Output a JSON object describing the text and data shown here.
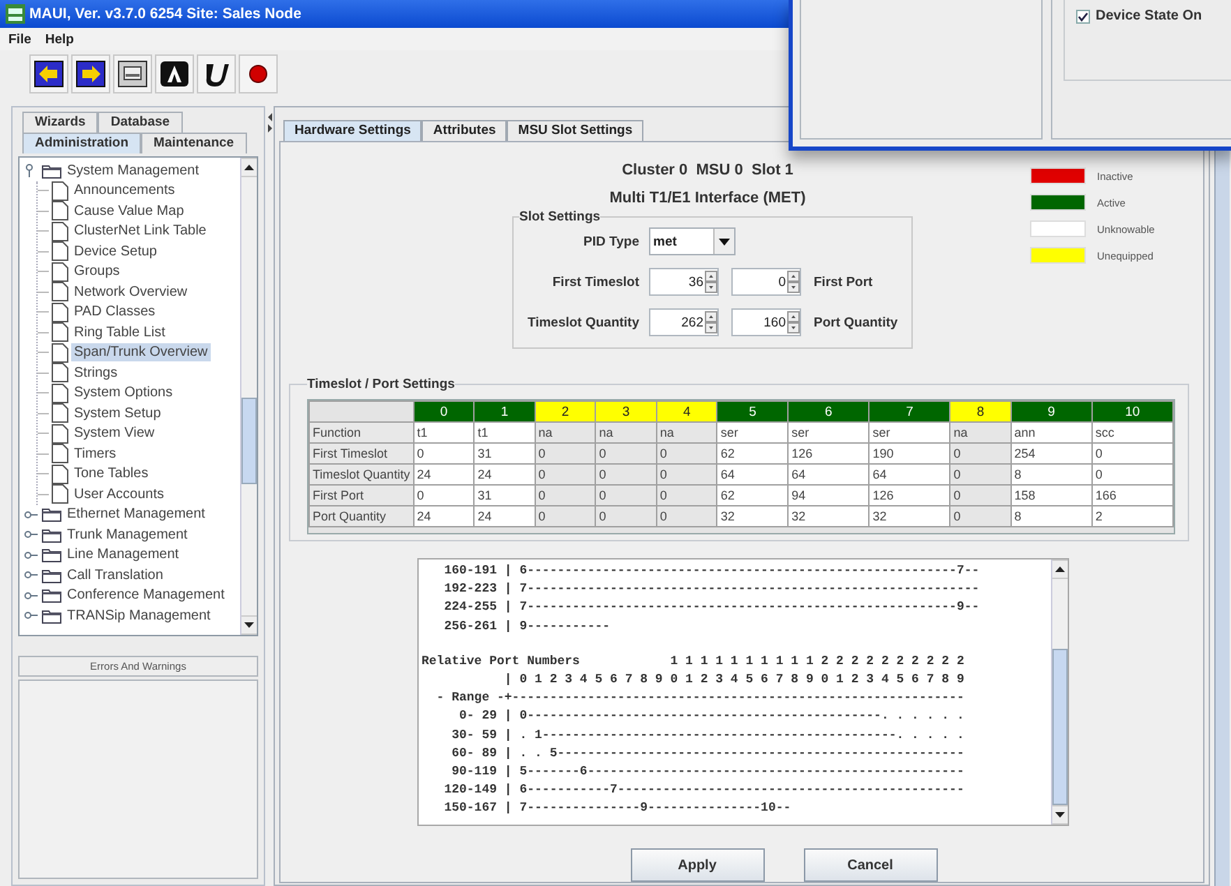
{
  "window": {
    "title": "MAUI, Ver. v3.7.0 6254 Site: Sales Node"
  },
  "menu": [
    "File",
    "Help"
  ],
  "toolbar": [
    {
      "kind": "back"
    },
    {
      "kind": "forward"
    },
    {
      "kind": "print"
    },
    {
      "kind": "letter-a"
    },
    {
      "kind": "letter-u"
    },
    {
      "kind": "record"
    }
  ],
  "left_panel": {
    "tab_rows": [
      [
        {
          "label": "Wizards",
          "selected": false
        },
        {
          "label": "Database",
          "selected": false
        }
      ],
      [
        {
          "label": "Administration",
          "selected": true
        },
        {
          "label": "Maintenance",
          "selected": false
        }
      ]
    ],
    "tree": [
      {
        "label": "System Management",
        "expanded": true,
        "selected": false,
        "children": [
          {
            "label": "Announcements",
            "selected": false
          },
          {
            "label": "Cause Value Map",
            "selected": false
          },
          {
            "label": "ClusterNet Link Table",
            "selected": false
          },
          {
            "label": "Device Setup",
            "selected": false
          },
          {
            "label": "Groups",
            "selected": false
          },
          {
            "label": "Network Overview",
            "selected": false
          },
          {
            "label": "PAD Classes",
            "selected": false
          },
          {
            "label": "Ring Table List",
            "selected": false
          },
          {
            "label": "Span/Trunk Overview",
            "selected": true
          },
          {
            "label": "Strings",
            "selected": false
          },
          {
            "label": "System Options",
            "selected": false
          },
          {
            "label": "System Setup",
            "selected": false
          },
          {
            "label": "System View",
            "selected": false
          },
          {
            "label": "Timers",
            "selected": false
          },
          {
            "label": "Tone Tables",
            "selected": false
          },
          {
            "label": "User Accounts",
            "selected": false
          }
        ]
      },
      {
        "label": "Ethernet Management",
        "expanded": false,
        "selected": false
      },
      {
        "label": "Trunk Management",
        "expanded": false,
        "selected": false
      },
      {
        "label": "Line Management",
        "expanded": false,
        "selected": false
      },
      {
        "label": "Call Translation",
        "expanded": false,
        "selected": false
      },
      {
        "label": "Conference Management",
        "expanded": false,
        "selected": false
      },
      {
        "label": "TRANSip Management",
        "expanded": false,
        "selected": false
      }
    ],
    "errors_panel": {
      "title": "Errors And Warnings"
    }
  },
  "main_panel": {
    "tabs": [
      {
        "label": "Hardware Settings",
        "selected": true
      },
      {
        "label": "Attributes",
        "selected": false
      },
      {
        "label": "MSU Slot Settings",
        "selected": false
      }
    ],
    "heading": "Cluster 0  MSU 0  Slot 1",
    "subheading": "Multi T1/E1 Interface (MET)",
    "slot_settings": {
      "title": "Slot Settings",
      "pid_type": {
        "label": "PID Type",
        "value": "met"
      },
      "first_timeslot": {
        "label": "First Timeslot",
        "value": "36"
      },
      "first_port": {
        "label": "First Port",
        "value": "0"
      },
      "timeslot_quantity": {
        "label": "Timeslot Quantity",
        "value": "262"
      },
      "port_quantity": {
        "label": "Port Quantity",
        "value": "160"
      }
    },
    "legend": [
      {
        "label": "Inactive",
        "color": "#e00000"
      },
      {
        "label": "Active",
        "color": "#006600"
      },
      {
        "label": "Unknowable",
        "color": "#ffffff"
      },
      {
        "label": "Unequipped",
        "color": "#ffff00"
      }
    ],
    "port_settings": {
      "title": "Timeslot / Port Settings",
      "columns": [
        {
          "label": "0",
          "color": "#006600",
          "equipped": true
        },
        {
          "label": "1",
          "color": "#006600",
          "equipped": true
        },
        {
          "label": "2",
          "color": "#ffff00",
          "equipped": false
        },
        {
          "label": "3",
          "color": "#ffff00",
          "equipped": false
        },
        {
          "label": "4",
          "color": "#ffff00",
          "equipped": false
        },
        {
          "label": "5",
          "color": "#006600",
          "equipped": true
        },
        {
          "label": "6",
          "color": "#006600",
          "equipped": true
        },
        {
          "label": "7",
          "color": "#006600",
          "equipped": true
        },
        {
          "label": "8",
          "color": "#ffff00",
          "equipped": false
        },
        {
          "label": "9",
          "color": "#006600",
          "equipped": true
        },
        {
          "label": "10",
          "color": "#006600",
          "equipped": true
        }
      ],
      "rows": [
        {
          "label": "Function",
          "cells": [
            "t1",
            "t1",
            "na",
            "na",
            "na",
            "ser",
            "ser",
            "ser",
            "na",
            "ann",
            "scc"
          ]
        },
        {
          "label": "First Timeslot",
          "cells": [
            "0",
            "31",
            "0",
            "0",
            "0",
            "62",
            "126",
            "190",
            "0",
            "254",
            "0"
          ]
        },
        {
          "label": "Timeslot Quantity",
          "cells": [
            "24",
            "24",
            "0",
            "0",
            "0",
            "64",
            "64",
            "64",
            "0",
            "8",
            "0"
          ]
        },
        {
          "label": "First Port",
          "cells": [
            "0",
            "31",
            "0",
            "0",
            "0",
            "62",
            "94",
            "126",
            "0",
            "158",
            "166"
          ]
        },
        {
          "label": "Port Quantity",
          "cells": [
            "24",
            "24",
            "0",
            "0",
            "0",
            "32",
            "32",
            "32",
            "0",
            "8",
            "2"
          ]
        }
      ]
    },
    "report_sections": [
      [
        "   160-191 | 6---------------------------------------------------------7--",
        "   192-223 | 7------------------------------------------------------------",
        "   224-255 | 7---------------------------------------------------------9--",
        "   256-261 | 9-----------"
      ],
      [
        "Relative Port Numbers            1 1 1 1 1 1 1 1 1 1 2 2 2 2 2 2 2 2 2 2",
        "           | 0 1 2 3 4 5 6 7 8 9 0 1 2 3 4 5 6 7 8 9 0 1 2 3 4 5 6 7 8 9",
        "  - Range -+------------------------------------------------------------",
        "     0- 29 | 0-----------------------------------------------. . . . . .",
        "    30- 59 | . 1-----------------------------------------------. . . . .",
        "    60- 89 | . . 5------------------------------------------------------",
        "    90-119 | 5-------6--------------------------------------------------",
        "   120-149 | 6-----------7----------------------------------------------",
        "   150-167 | 7---------------9---------------10--"
      ]
    ],
    "buttons": [
      "Apply",
      "Cancel"
    ]
  },
  "overlay_window": {
    "checkbox": {
      "label": "Device State On",
      "checked": true
    }
  }
}
